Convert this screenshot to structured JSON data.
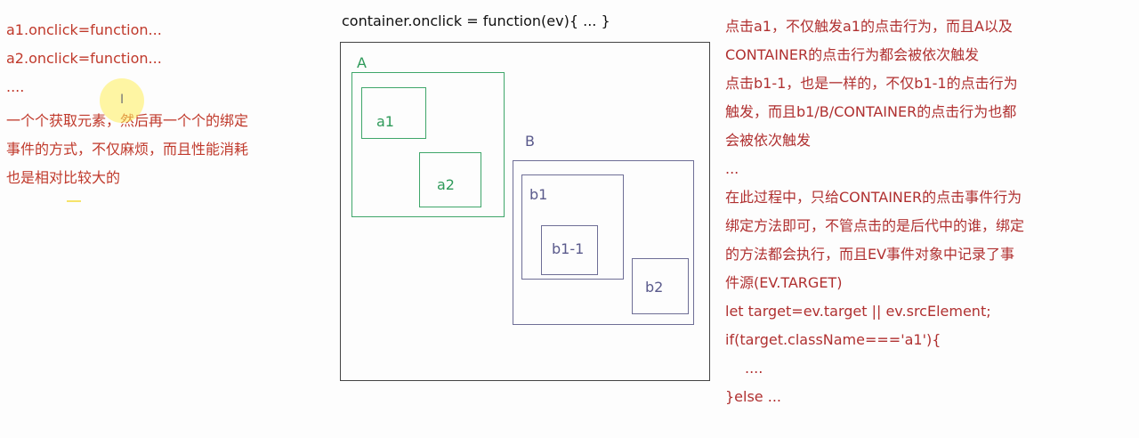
{
  "left": {
    "lines": [
      "a1.onclick=function...",
      "a2.onclick=function...",
      "...."
    ],
    "para": [
      "一个个获取元素，然后再一个个的绑定",
      "事件的方式，不仅麻烦，而且性能消耗",
      "也是相对比较大的"
    ]
  },
  "diagram": {
    "title": "container.onclick = function(ev){  ...  }",
    "labels": {
      "A": "A",
      "a1": "a1",
      "a2": "a2",
      "B": "B",
      "b1": "b1",
      "b1_1": "b1-1",
      "b2": "b2"
    }
  },
  "right": {
    "lines": [
      "点击a1，不仅触发a1的点击行为，而且A以及",
      "CONTAINER的点击行为都会被依次触发",
      "点击b1-1，也是一样的，不仅b1-1的点击行为",
      "触发，而且b1/B/CONTAINER的点击行为也都",
      "会被依次触发",
      "...",
      "在此过程中，只给CONTAINER的点击事件行为",
      "绑定方法即可，不管点击的是后代中的谁，绑定",
      "的方法都会执行，而且EV事件对象中记录了事",
      "件源(EV.TARGET)",
      "let target=ev.target || ev.srcElement;",
      "if(target.className==='a1'){",
      "....",
      "}else ..."
    ]
  },
  "colors": {
    "text_red": "#c0392b",
    "group_a": "#3fa66a",
    "group_b": "#6e6e96",
    "container": "#444444"
  }
}
